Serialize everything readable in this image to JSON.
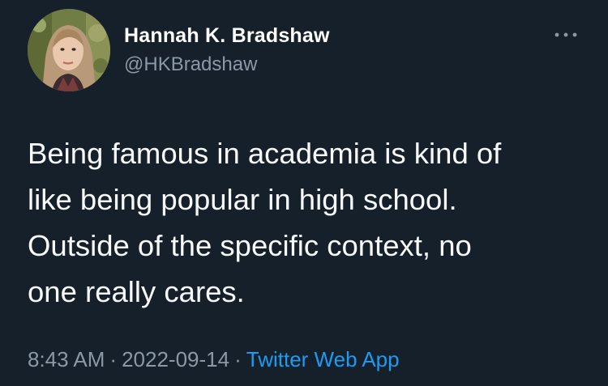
{
  "author": {
    "display_name": "Hannah K. Bradshaw",
    "handle": "@HKBradshaw"
  },
  "menu": {
    "icon": "more-horizontal-icon"
  },
  "tweet": {
    "text": "Being famous in academia is kind of\nlike being popular in high school.\nOutside of the specific context, no\none really cares."
  },
  "meta": {
    "time": "8:43 AM",
    "separator": "·",
    "date": "2022-09-14",
    "source": "Twitter Web App"
  },
  "colors": {
    "background": "#15202b",
    "text": "#f7f9f9",
    "secondary_text": "#8b98a5",
    "link": "#1d9bf0"
  }
}
